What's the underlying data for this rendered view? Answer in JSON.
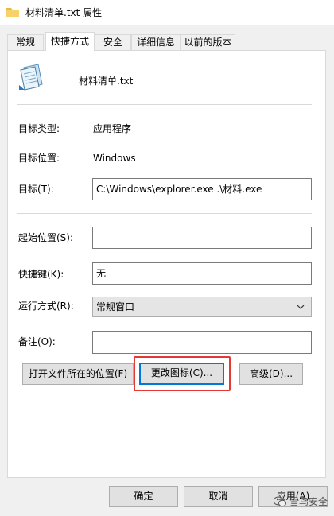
{
  "window": {
    "title": "材料清单.txt 属性"
  },
  "tabs": [
    {
      "label": "常规",
      "active": false
    },
    {
      "label": "快捷方式",
      "active": true
    },
    {
      "label": "安全",
      "active": false
    },
    {
      "label": "详细信息",
      "active": false
    },
    {
      "label": "以前的版本",
      "active": false
    }
  ],
  "shortcut": {
    "name": "材料清单.txt",
    "target_type_label": "目标类型:",
    "target_type_value": "应用程序",
    "target_location_label": "目标位置:",
    "target_location_value": "Windows",
    "target_label": "目标(T):",
    "target_value": "C:\\Windows\\explorer.exe .\\材料.exe",
    "start_in_label": "起始位置(S):",
    "start_in_value": "",
    "hotkey_label": "快捷键(K):",
    "hotkey_value": "无",
    "run_label": "运行方式(R):",
    "run_value": "常规窗口",
    "comment_label": "备注(O):",
    "comment_value": "",
    "open_location_button": "打开文件所在的位置(F)",
    "change_icon_button": "更改图标(C)...",
    "advanced_button": "高级(D)..."
  },
  "footer": {
    "ok": "确定",
    "cancel": "取消",
    "apply": "应用(A)"
  },
  "watermark": "雪鸟安全",
  "colors": {
    "highlight": "#e53935",
    "focus": "#0078d7"
  }
}
